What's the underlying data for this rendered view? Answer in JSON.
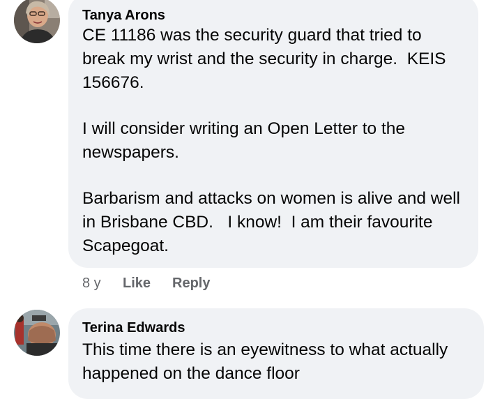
{
  "comments": [
    {
      "author": "Tanya Arons",
      "paragraphs": [
        "CE 11186 was the security guard that tried to break my wrist and the security in charge.  KEIS 156676.",
        "I will consider writing an Open Letter to the newspapers.",
        "Barbarism and attacks on women is alive and well in Brisbane CBD.   I know!  I am their favourite Scapegoat."
      ],
      "time": "8 y",
      "like_label": "Like",
      "reply_label": "Reply"
    },
    {
      "author": "Terina Edwards",
      "paragraphs": [
        "This time there is an eyewitness to what actually happened on the dance floor"
      ]
    }
  ],
  "colors": {
    "bubble": "#f0f2f5",
    "text": "#050505",
    "meta": "#65676b"
  }
}
